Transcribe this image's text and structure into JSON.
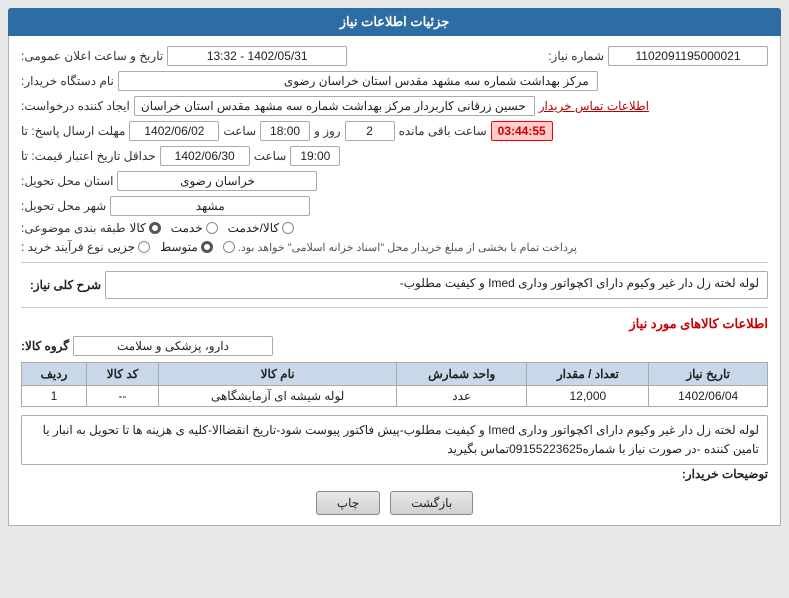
{
  "page": {
    "header": "جزئیات اطلاعات نیاز",
    "fields": {
      "shomareNiaz_label": "شماره نیاز:",
      "shomareNiaz_value": "1102091195000021",
      "namdastgah_label": "نام دستگاه خریدار:",
      "namdastgah_value": "مرکز بهداشت شماره سه مشهد مقدس استان خراسان رضوی",
      "ijad_label": "ایجاد کننده درخواست:",
      "ijad_value": "حسین زرقانی کاربردار مرکز بهداشت شماره سه مشهد مقدس استان خراسان",
      "ijad_link": "اطلاعات تماس خریدار",
      "mohlat_label": "مهلت ارسال پاسخ: تا",
      "mohlat_date": "1402/06/02",
      "mohlat_saat_label": "ساعت",
      "mohlat_saat": "18:00",
      "mohlat_ruz_label": "روز و",
      "mohlat_ruz": "2",
      "mohlat_mande_label": "ساعت باقی مانده",
      "mohlat_mande": "03:44:55",
      "hadaghal_label": "حداقل تاریخ اعتبار قیمت: تا",
      "hadaghal_date": "1402/06/30",
      "hadaghal_saat_label": "ساعت",
      "hadaghal_saat": "19:00",
      "ostan_label": "استان محل تحویل:",
      "ostan_value": "خراسان رضوی",
      "shahr_label": "شهر محل تحویل:",
      "shahr_value": "مشهد",
      "tabaghe_label": "طبقه بندی موضوعی:",
      "tabaghe_options": [
        {
          "label": "کالا",
          "selected": true
        },
        {
          "label": "خدمت",
          "selected": false
        },
        {
          "label": "کالا/خدمت",
          "selected": false
        }
      ],
      "noeFarayand_label": "نوع فرآیند خرید :",
      "noeFarayand_options": [
        {
          "label": "جزیی",
          "selected": false
        },
        {
          "label": "متوسط",
          "selected": true
        },
        {
          "label": "پرداخت تمام یا بخشی از مبلغ خریدار محل \"اسناد خزانه اسلامی\" خواهد بود.",
          "selected": false
        }
      ],
      "sharh_label": "شرح کلی نیاز:",
      "sharh_value": "لوله لخته زل دار غیر وکیوم دارای اکچواتور وداری Imed و کیفیت مطلوب-",
      "group_label": "گروه کالا:",
      "group_value": "دارو، پزشکی و سلامت"
    },
    "table": {
      "headers": [
        "ردیف",
        "کد کالا",
        "نام کالا",
        "واحد شمارش",
        "تعداد / مقدار",
        "تاریخ نیاز"
      ],
      "rows": [
        {
          "radif": "1",
          "kod": "--",
          "nam": "لوله شیشه ای آزمایشگاهی",
          "vahed": "عدد",
          "tedad": "12,000",
          "tarikh": "1402/06/04"
        }
      ]
    },
    "notes_label": "توضیحات خریدار:",
    "notes_value": "لوله لخته زل دار غیر وکیوم دارای اکچواتور وداری Imed و کیفیت مطلوب-پیش فاکتور پیوست شود-تاریخ انقضاالا-کلیه ی هزینه ها تا تحویل به انبار یا تامین کننده -در صورت نیاز با شماره09155223625تماس بگیرید",
    "buttons": {
      "print": "چاپ",
      "back": "بازگشت"
    }
  }
}
